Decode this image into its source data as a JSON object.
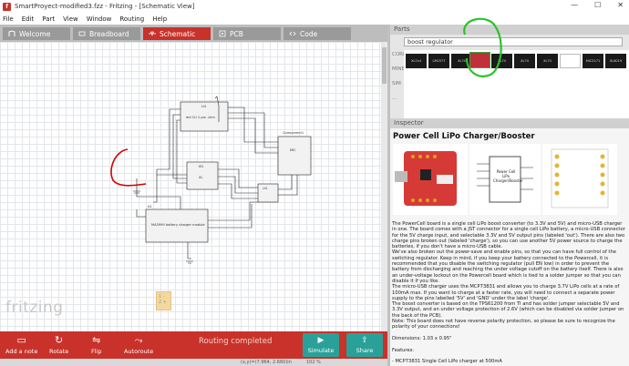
{
  "window": {
    "title": "SmartProyect-modified3.fzz - Fritzing - [Schematic View]",
    "minimize": "—",
    "maximize": "☐",
    "close": "✕"
  },
  "menu": [
    "File",
    "Edit",
    "Part",
    "View",
    "Window",
    "Routing",
    "Help"
  ],
  "tabs": [
    {
      "label": "Welcome",
      "icon": "welcome-icon"
    },
    {
      "label": "Breadboard",
      "icon": "breadboard-icon"
    },
    {
      "label": "Schematic",
      "icon": "schematic-icon",
      "active": true
    },
    {
      "label": "PCB",
      "icon": "pcb-icon"
    },
    {
      "label": "Code",
      "icon": "code-icon"
    }
  ],
  "schematic": {
    "labels": {
      "u1": "U4",
      "u1_text": "led CU 1-pin -trim",
      "comp": "Component1",
      "comp_sub": "MIC",
      "u2": "M1",
      "u2_text": "XL",
      "u3": "A1",
      "u3_text": "MA3999 battery charger module",
      "small": "U4"
    },
    "note": {
      "line1": "1 -",
      "line2": "2 +"
    }
  },
  "logo": "fritzing",
  "bottombar": {
    "add_note": "Add a note",
    "rotate": "Rotate",
    "flip": "Flip",
    "autoroute": "Autoroute",
    "routing_status": "Routing completed",
    "simulate": "Simulate",
    "share": "Share"
  },
  "statusbar": {
    "coords": "(x,y)=(7.964, 2.660)in",
    "zoom": "102 %"
  },
  "parts": {
    "header": "Parts",
    "search_value": "boost regulator",
    "side": [
      "CORE",
      "MINE",
      "SIM",
      "..."
    ],
    "items": [
      "XL7x4",
      "LM2577",
      "XL74",
      "",
      "XL74",
      "XL74",
      "XL74",
      "",
      "MIC2171",
      "XL6019"
    ]
  },
  "inspector": {
    "header": "Inspector",
    "title": "Power Cell LiPo Charger/Booster",
    "img_label": "Power Cell LiPo Charger/Booster",
    "description": [
      "The PowerCell board is a single cell LiPo boost converter (to 3.3V and 5V) and micro-USB charger in one. The board comes with a JST connector for a single cell LiPo battery, a micro-USB connector for the 5V charge input, and selectable 3.3V and 5V output pins (labeled 'out'). There are also two charge pins broken out (labeled 'charge'), so you can use another 5V power source to charge the batteries, if you don't have a micro-USB cable.",
      "We've also broken out the power-save and enable pins, so that you can have full control of the switching regulator. Keep in mind, if you keep your battery connected to the Powercell, it is recommended that you disable the switching regulator (pull EN low) in order to prevent the battery from discharging and reaching the under voltage cutoff on the battery itself. There is also an under-voltage lockout on the Powercell board which is tied to a solder jumper so that you can disable it if you like.",
      "The micro-USB charger uses the MCP73831 and allows you to charge 3.7V LiPo cells at a rate of 100mA max. If you want to charge at a faster rate, you will need to connect a separate power supply to the pins labelled '5V' and 'GND' under the label 'charge'.",
      "The boost converter is based on the TPS61200 from TI and has solder jumper selectable 5V and 3.3V output, and an under voltage protection of 2.6V (which can be disabled via solder jumper on the back of the PCB).",
      "Note: This board does not have reverse polarity protection, so please be sure to recognize the polarity of your connections!",
      "",
      "Dimensions: 1.03 x 0.95\"",
      "",
      "Features:",
      "",
      "- MCP73831 Single Cell LiPo charger at 500mA"
    ]
  }
}
